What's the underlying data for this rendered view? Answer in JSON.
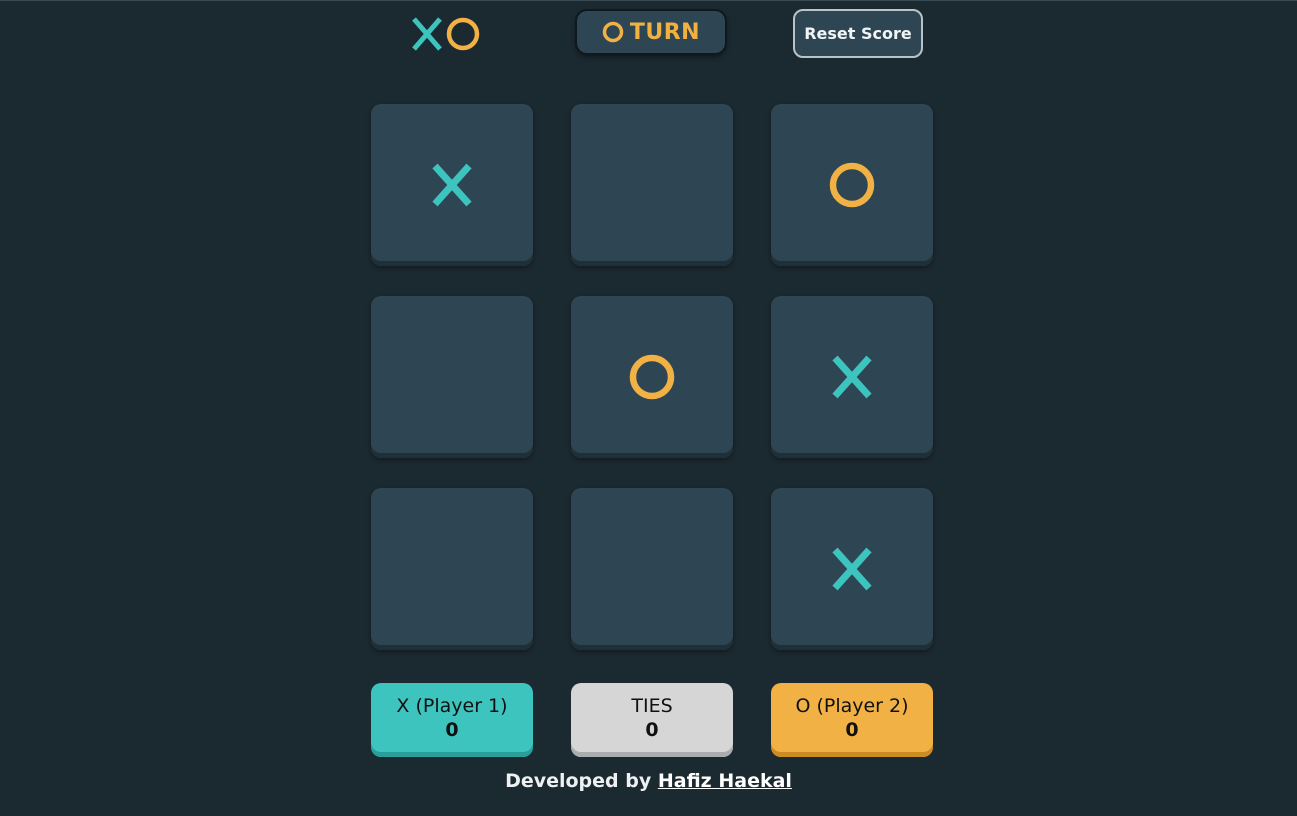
{
  "header": {
    "logo": {
      "x_icon": "x-icon",
      "o_icon": "o-icon"
    },
    "turn_indicator": {
      "icon": "o-icon",
      "label": "TURN"
    },
    "reset_button": {
      "label": "Reset Score"
    }
  },
  "board": {
    "cells": [
      "X",
      "",
      "O",
      "",
      "O",
      "X",
      "",
      "",
      "X"
    ]
  },
  "scoreboard": {
    "player1": {
      "label": "X (Player 1)",
      "value": "0"
    },
    "ties": {
      "label": "TIES",
      "value": "0"
    },
    "player2": {
      "label": "O (Player 2)",
      "value": "0"
    }
  },
  "footer": {
    "prefix": "Developed by",
    "author_link": "Hafiz Haekal"
  },
  "colors": {
    "background": "#1b2930",
    "tile": "#2e4554",
    "x_mark": "#3ec4bf",
    "o_mark": "#f2b144",
    "ties": "#d6d6d6"
  }
}
